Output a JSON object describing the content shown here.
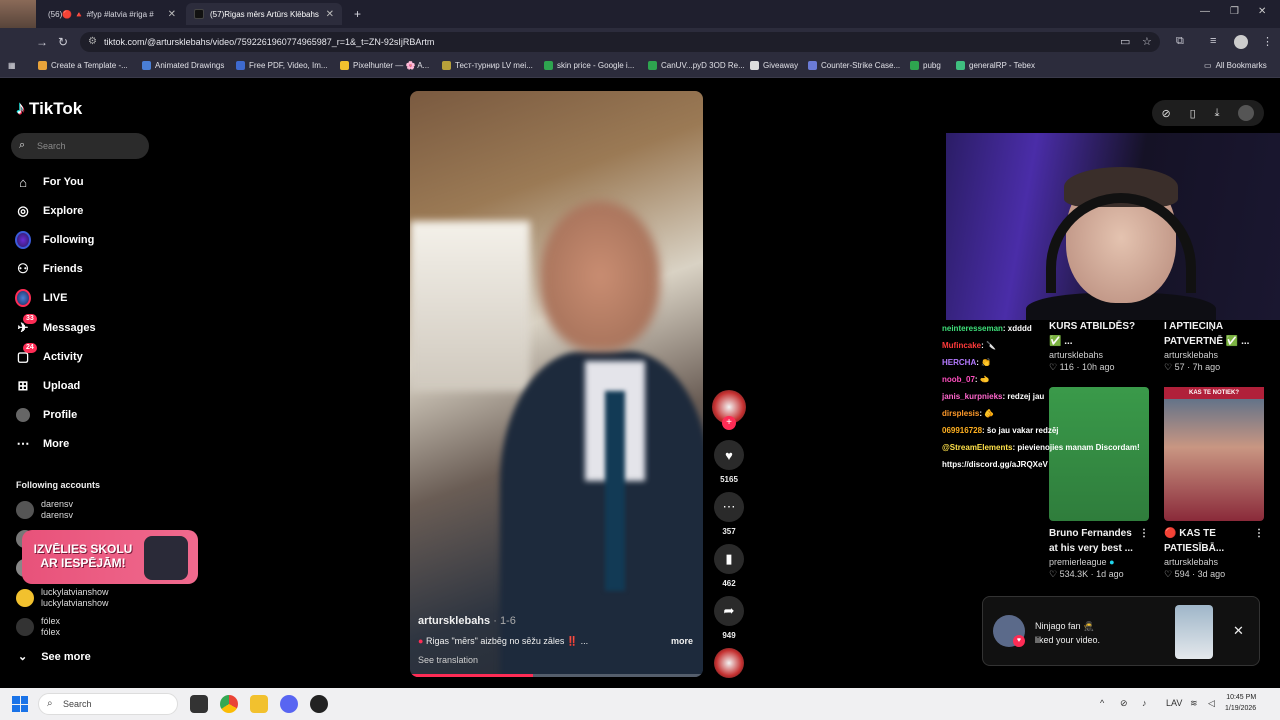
{
  "browser": {
    "tabs": [
      {
        "label": "(56)🔴 🔺 #fyp #latvia #riga #",
        "active": false
      },
      {
        "label": "(57)Rigas mērs Artūrs Klēbahs",
        "active": true
      }
    ],
    "url": "tiktok.com/@artursklebahs/video/7592261960774965987_r=1&_t=ZN-92sIjRBArtm",
    "bookmarks": [
      "Create a Template -...",
      "Animated Drawings",
      "Free PDF, Video, Im...",
      "Pixelhunter — 🌸 A...",
      "Тест-турнир LV mei...",
      "skin price - Google i...",
      "CanUV...pyD 3OD Re...",
      "Giveaway",
      "Counter-Strike Case...",
      "pubg",
      "generalRP - Tebex"
    ],
    "all_bookmarks": "All Bookmarks"
  },
  "sidebar": {
    "logo": "TikTok",
    "search_placeholder": "Search",
    "nav": [
      {
        "label": "For You",
        "icon": "home-icon"
      },
      {
        "label": "Explore",
        "icon": "compass-icon"
      },
      {
        "label": "Following",
        "icon": "following-icon"
      },
      {
        "label": "Friends",
        "icon": "friends-icon"
      },
      {
        "label": "LIVE",
        "icon": "live-icon"
      },
      {
        "label": "Messages",
        "icon": "messages-icon",
        "badge": "33"
      },
      {
        "label": "Activity",
        "icon": "activity-icon",
        "badge": "24"
      },
      {
        "label": "Upload",
        "icon": "upload-icon"
      },
      {
        "label": "Profile",
        "icon": "profile-icon"
      },
      {
        "label": "More",
        "icon": "more-icon"
      }
    ],
    "following_title": "Following accounts",
    "accounts": [
      {
        "name": "darensv",
        "handle": "darensv"
      },
      {
        "name": "luckylatvianshow",
        "handle": "luckylatvianshow"
      },
      {
        "name": "fólex",
        "handle": "fólex"
      }
    ],
    "promo": "IZVĒLIES SKOLU AR IESPĒJĀM!",
    "see_more": "See more"
  },
  "video": {
    "author": "artursklebahs",
    "author_suffix": "· 1-6",
    "caption": "Rigas \"mērs\" aizbēg no sēžu zāles ‼️ ...",
    "more": "more",
    "see_translation": "See translation",
    "progress_percent": 42,
    "likes": "5165",
    "comments": "357",
    "saves": "462",
    "shares": "949"
  },
  "chat": [
    {
      "user": "neinteresseman",
      "msg": ": xdddd",
      "color": "#3ee07a"
    },
    {
      "user": "Mufincake",
      "msg": ": 🔪",
      "color": "#ff3a3a"
    },
    {
      "user": "HERCHA",
      "msg": ": 👏",
      "color": "#b47aff"
    },
    {
      "user": "noob_07",
      "msg": ": 🫲",
      "color": "#ff4fbf"
    },
    {
      "user": "janis_kurpnieks",
      "msg": ": redzej jau",
      "color": "#ff66cc"
    },
    {
      "user": "dirsplesis",
      "msg": ": 🫵",
      "color": "#ff9a2a"
    },
    {
      "user": "069916728",
      "msg": ": šo jau vakar redzēj",
      "color": "#ffb020"
    },
    {
      "user": "@StreamElements",
      "msg": ": pievienojies manam Discordam!",
      "color": "#ffe14a"
    },
    {
      "user": "",
      "msg": "https://discord.gg/aJRQXeV",
      "color": "#ffffff"
    }
  ],
  "cards": [
    {
      "title": "KURS ATBILDĒS? ✅ ...",
      "author": "artursklebahs",
      "likes": "116",
      "age": "10h ago"
    },
    {
      "title": "I APTIECIŅA PATVERTNĒ ✅ ...",
      "author": "artursklebahs",
      "likes": "57",
      "age": "7h ago"
    },
    {
      "title": "Bruno Fernandes at his very best ...",
      "author": "premierleague",
      "likes": "534.3K",
      "age": "1d ago"
    },
    {
      "title": "🔴 KAS TE PATIESĪBĀ...",
      "author": "artursklebahs",
      "likes": "594",
      "age": "3d ago",
      "thumb_label": "KAS TE NOTIEK?"
    }
  ],
  "toast": {
    "line1": "Ninjago fan 🥷",
    "line2": "liked your video."
  },
  "taskbar": {
    "search": "Search",
    "lang": "LAV",
    "time": "10:45 PM",
    "date": "1/19/2026"
  }
}
